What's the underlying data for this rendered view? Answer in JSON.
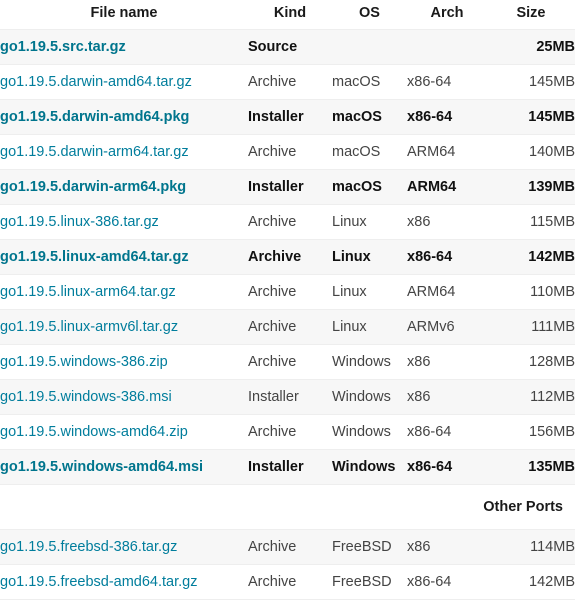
{
  "table": {
    "columns": [
      {
        "key": "filename",
        "label": "File name"
      },
      {
        "key": "kind",
        "label": "Kind"
      },
      {
        "key": "os",
        "label": "OS"
      },
      {
        "key": "arch",
        "label": "Arch"
      },
      {
        "key": "size",
        "label": "Size"
      }
    ],
    "link_color": "#007d9c",
    "shade_color": "#f7f7f7",
    "border_color": "#eeeeee",
    "section_label": "Other Ports",
    "rows": [
      {
        "filename": "go1.19.5.src.tar.gz",
        "kind": "Source",
        "os": "",
        "arch": "",
        "size": "25MB",
        "featured": true
      },
      {
        "filename": "go1.19.5.darwin-amd64.tar.gz",
        "kind": "Archive",
        "os": "macOS",
        "arch": "x86-64",
        "size": "145MB",
        "featured": false
      },
      {
        "filename": "go1.19.5.darwin-amd64.pkg",
        "kind": "Installer",
        "os": "macOS",
        "arch": "x86-64",
        "size": "145MB",
        "featured": true
      },
      {
        "filename": "go1.19.5.darwin-arm64.tar.gz",
        "kind": "Archive",
        "os": "macOS",
        "arch": "ARM64",
        "size": "140MB",
        "featured": false
      },
      {
        "filename": "go1.19.5.darwin-arm64.pkg",
        "kind": "Installer",
        "os": "macOS",
        "arch": "ARM64",
        "size": "139MB",
        "featured": true
      },
      {
        "filename": "go1.19.5.linux-386.tar.gz",
        "kind": "Archive",
        "os": "Linux",
        "arch": "x86",
        "size": "115MB",
        "featured": false
      },
      {
        "filename": "go1.19.5.linux-amd64.tar.gz",
        "kind": "Archive",
        "os": "Linux",
        "arch": "x86-64",
        "size": "142MB",
        "featured": true
      },
      {
        "filename": "go1.19.5.linux-arm64.tar.gz",
        "kind": "Archive",
        "os": "Linux",
        "arch": "ARM64",
        "size": "110MB",
        "featured": false
      },
      {
        "filename": "go1.19.5.linux-armv6l.tar.gz",
        "kind": "Archive",
        "os": "Linux",
        "arch": "ARMv6",
        "size": "111MB",
        "featured": false
      },
      {
        "filename": "go1.19.5.windows-386.zip",
        "kind": "Archive",
        "os": "Windows",
        "arch": "x86",
        "size": "128MB",
        "featured": false
      },
      {
        "filename": "go1.19.5.windows-386.msi",
        "kind": "Installer",
        "os": "Windows",
        "arch": "x86",
        "size": "112MB",
        "featured": false
      },
      {
        "filename": "go1.19.5.windows-amd64.zip",
        "kind": "Archive",
        "os": "Windows",
        "arch": "x86-64",
        "size": "156MB",
        "featured": false
      },
      {
        "filename": "go1.19.5.windows-amd64.msi",
        "kind": "Installer",
        "os": "Windows",
        "arch": "x86-64",
        "size": "135MB",
        "featured": true
      }
    ],
    "other_ports_rows": [
      {
        "filename": "go1.19.5.freebsd-386.tar.gz",
        "kind": "Archive",
        "os": "FreeBSD",
        "arch": "x86",
        "size": "114MB",
        "featured": false
      },
      {
        "filename": "go1.19.5.freebsd-amd64.tar.gz",
        "kind": "Archive",
        "os": "FreeBSD",
        "arch": "x86-64",
        "size": "142MB",
        "featured": false
      }
    ]
  }
}
